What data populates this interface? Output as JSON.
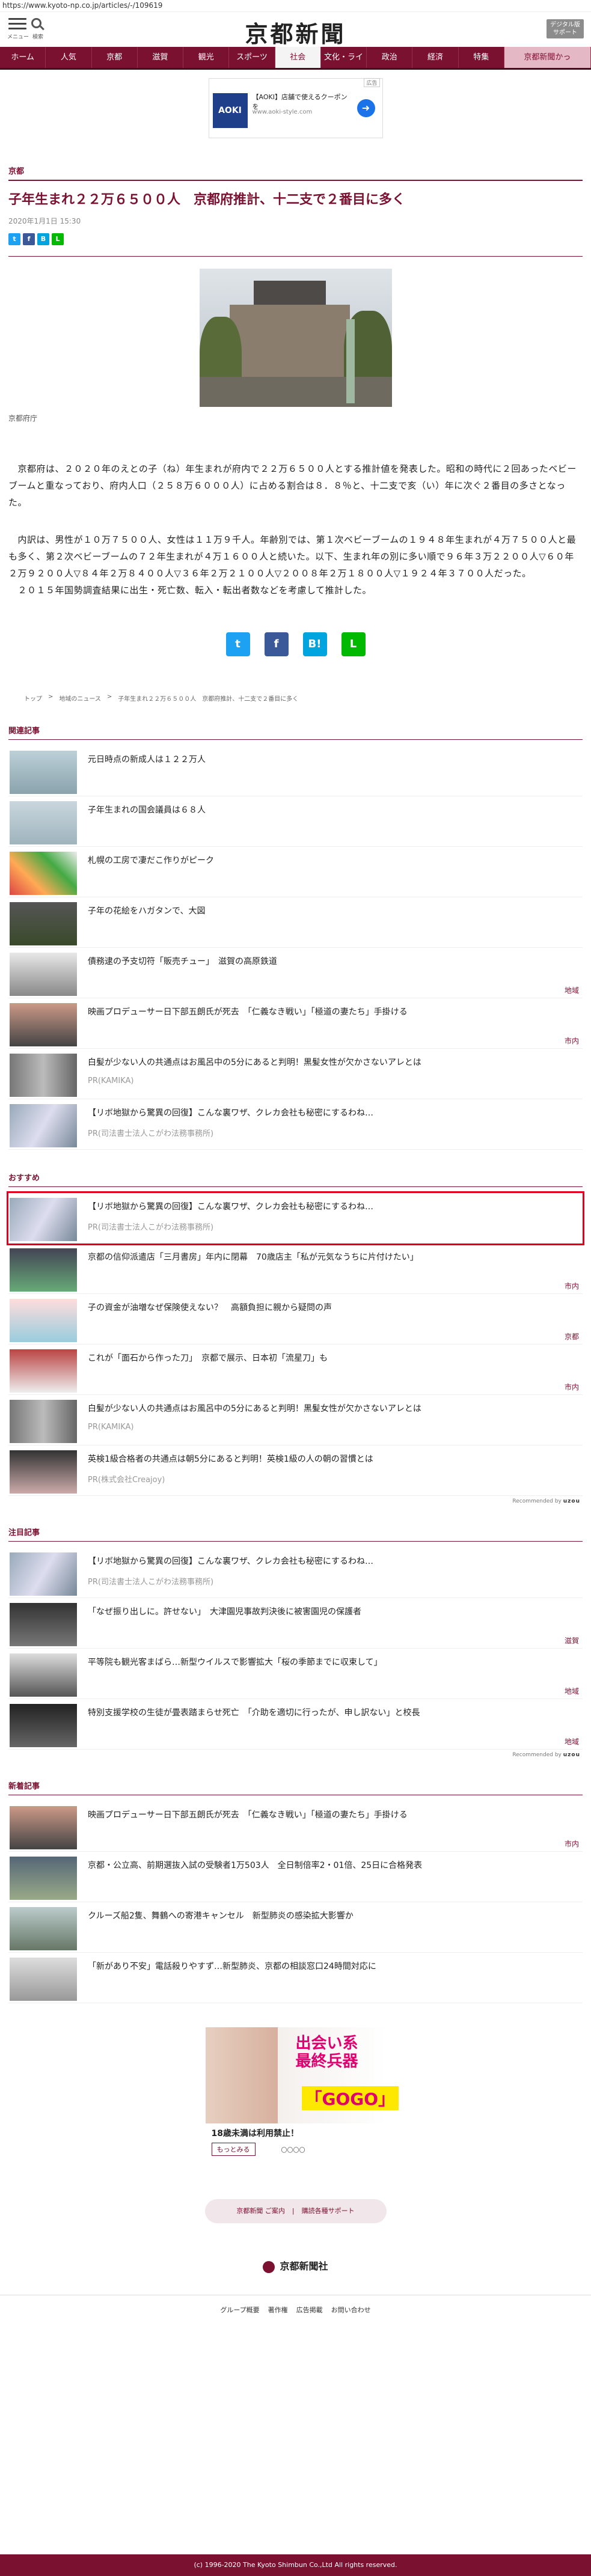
{
  "url": "https://www.kyoto-np.co.jp/articles/-/109619",
  "header": {
    "menu_label": "メニュー",
    "search_label": "検索",
    "logo": "京都新聞",
    "digital": "デジタル版\nサポート"
  },
  "nav": [
    "ホーム",
    "人気",
    "京都",
    "滋賀",
    "観光",
    "スポーツ",
    "社会",
    "文化・ライフ",
    "政治",
    "経済",
    "特集",
    "京都新聞かっ"
  ],
  "ad_top": {
    "tag": "広告",
    "brand": "AOKI",
    "text": "【AOKI】店舗で使えるクーポンを",
    "sub": "www.aoki-style.com"
  },
  "article": {
    "category": "京都",
    "headline": "子年生まれ２２万６５００人　京都府推計、十二支で２番目に多く",
    "date": "2020年1月1日 15:30",
    "caption": "京都府庁",
    "paragraphs": [
      "　京都府は、２０２０年のえとの子（ね）年生まれが府内で２２万６５００人とする推計値を発表した。昭和の時代に２回あったベビーブームと重なっており、府内人口（２５８万６０００人）に占める割合は８．８％と、十二支で亥（い）年に次ぐ２番目の多さとなった。",
      "　内訳は、男性が１０万７５００人、女性は１１万９千人。年齢別では、第１次ベビーブームの１９４８年生まれが４万７５００人と最も多く、第２次ベビーブームの７２年生まれが４万１６００人と続いた。以下、生まれ年の別に多い順で９６年３万２２００人▽６０年２万９２００人▽８４年２万８４００人▽３６年２万２１００人▽２００８年２万１８００人▽１９２４年３７００人だった。",
      "　２０１５年国勢調査結果に出生・死亡数、転入・転出者数などを考慮して推計した。"
    ]
  },
  "breadcrumb": [
    "トップ",
    ">",
    "地域のニュース",
    ">",
    "子年生まれ２２万６５００人　京都府推計、十二支で２番目に多く"
  ],
  "related": {
    "title": "関連記事",
    "items": [
      {
        "title": "元日時点の新成人は１２２万人",
        "region": ""
      },
      {
        "title": "子年生まれの国会議員は６８人",
        "region": ""
      },
      {
        "title": "札幌の工房で凄だこ作りがピーク",
        "region": ""
      },
      {
        "title": "子年の花絵をハガタンで、大図",
        "region": ""
      },
      {
        "title": "債務逮の予支切符「販売チュー」　滋賀の高原鉄道",
        "region": "地域"
      },
      {
        "title": "映画プロデューサー日下部五朗氏が死去　「仁義なき戦い」「極道の妻たち」手掛ける",
        "region": "市内"
      },
      {
        "title": "白髪が少ない人の共通点はお風呂中の5分にあると判明！黒髪女性が欠かさないアレとは",
        "sub": "PR(KAMIKA)",
        "region": ""
      },
      {
        "title": "【リボ地獄から驚異の回復】こんな裏ワザ、クレカ会社も秘密にするわね…",
        "sub": "PR(司法書士法人こがわ法務事務所)",
        "region": ""
      }
    ]
  },
  "recommend": {
    "title": "おすすめ",
    "items": [
      {
        "title": "【リボ地獄から驚異の回復】こんな裏ワザ、クレカ会社も秘密にするわね…",
        "sub": "PR(司法書士法人こがわ法務事務所)",
        "region": ""
      },
      {
        "title": "京都の信仰派遣店「三月書房」年内に閉幕　70歳店主「私が元気なうちに片付けたい」",
        "region": "市内"
      },
      {
        "title": "子の資金が油増なぜ保険使えない？　高額負担に親から疑問の声",
        "region": "京都"
      },
      {
        "title": "これが「面石から作った刀」　京都で展示、日本初「流星刀」も",
        "region": "市内"
      },
      {
        "title": "白髪が少ない人の共通点はお風呂中の5分にあると判明！黒髪女性が欠かさないアレとは",
        "sub": "PR(KAMIKA)",
        "region": ""
      },
      {
        "title": "英検1級合格者の共通点は朝5分にあると判明！英検1級の人の朝の習慣とは",
        "sub": "PR(株式会社Creajoy)",
        "region": ""
      }
    ],
    "recby": "Recommended by",
    "recby_brand": "uzou"
  },
  "notable": {
    "title": "注目記事",
    "items": [
      {
        "title": "【リボ地獄から驚異の回復】こんな裏ワザ、クレカ会社も秘密にするわね…",
        "sub": "PR(司法書士法人こがわ法務事務所)",
        "region": ""
      },
      {
        "title": "「なぜ振り出しに。許せない」　大津園児事故判決後に被害園児の保護者",
        "region": "滋賀"
      },
      {
        "title": "平等院も観光客まばら…新型ウイルスで影響拡大「桜の季節までに収束して」",
        "region": "地域"
      },
      {
        "title": "特別支援学校の生徒が畳表踏まらせ死亡　「介助を適切に行ったが、申し訳ない」と校長",
        "region": "地域"
      }
    ],
    "recby": "Recommended by",
    "recby_brand": "uzou"
  },
  "latest": {
    "title": "新着記事",
    "items": [
      {
        "title": "映画プロデューサー日下部五朗氏が死去　「仁義なき戦い」「極道の妻たち」手掛ける",
        "region": "市内"
      },
      {
        "title": "京都・公立高、前期選抜入試の受験者1万503人　全日制倍率2・01倍、25日に合格発表",
        "region": ""
      },
      {
        "title": "クルーズ船2隻、舞鶴への寄港キャンセル　新型肺炎の感染拡大影響か",
        "region": ""
      },
      {
        "title": "「新があり不安」電話殺りやすず…新型肺炎、京都の相談窓口24時間対応に",
        "region": ""
      }
    ]
  },
  "ad_bottom": {
    "c1": "出会い系\n最終兵器",
    "c2": "「GOGO」",
    "warn": "18歳未満は利用禁止！",
    "more": "もっとみる",
    "dots": "〇〇〇〇"
  },
  "footer": {
    "links": [
      "京都新聞 ご案内",
      "|",
      "購読各種サポート"
    ],
    "logo": "京都新聞社",
    "bottom_links": [
      "グループ概要",
      "著作権",
      "広告掲載",
      "お問い合わせ"
    ],
    "copyright": "(c) 1996-2020 The Kyoto Shimbun Co.,Ltd All rights reserved."
  },
  "colors": {
    "brand": "#7b1131",
    "highlight": "#e0001b"
  }
}
